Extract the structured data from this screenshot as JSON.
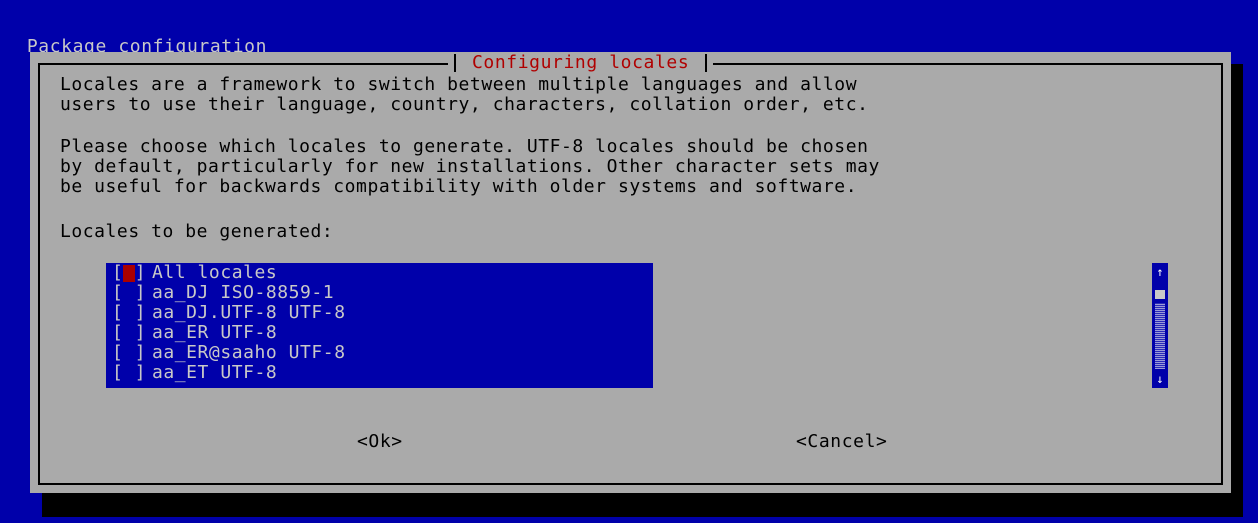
{
  "window": {
    "title": "Package configuration"
  },
  "dialog": {
    "title": "Configuring locales",
    "paragraph1": [
      "Locales are a framework to switch between multiple languages and allow",
      "users to use their language, country, characters, collation order, etc."
    ],
    "paragraph2": [
      "Please choose which locales to generate. UTF-8 locales should be chosen",
      "by default, particularly for new installations. Other character sets may",
      "be useful for backwards compatibility with older systems and software."
    ],
    "list_label": "Locales to be generated:",
    "locales": [
      {
        "checkbox": "[ ]",
        "label": "All locales",
        "checked": false,
        "focused": true
      },
      {
        "checkbox": "[ ]",
        "label": "aa_DJ ISO-8859-1",
        "checked": false,
        "focused": false
      },
      {
        "checkbox": "[ ]",
        "label": "aa_DJ.UTF-8 UTF-8",
        "checked": false,
        "focused": false
      },
      {
        "checkbox": "[ ]",
        "label": "aa_ER UTF-8",
        "checked": false,
        "focused": false
      },
      {
        "checkbox": "[ ]",
        "label": "aa_ER@saaho UTF-8",
        "checked": false,
        "focused": false
      },
      {
        "checkbox": "[ ]",
        "label": "aa_ET UTF-8",
        "checked": false,
        "focused": false
      }
    ],
    "scrollbar": {
      "up_arrow": "↑",
      "down_arrow": "↓"
    },
    "buttons": {
      "ok": "<Ok>",
      "cancel": "<Cancel>"
    }
  },
  "colors": {
    "background": "#0000aa",
    "dialog": "#aaaaaa",
    "title_accent": "#b00000",
    "cursor": "#aa0000",
    "list_text": "#c8c8c8"
  }
}
